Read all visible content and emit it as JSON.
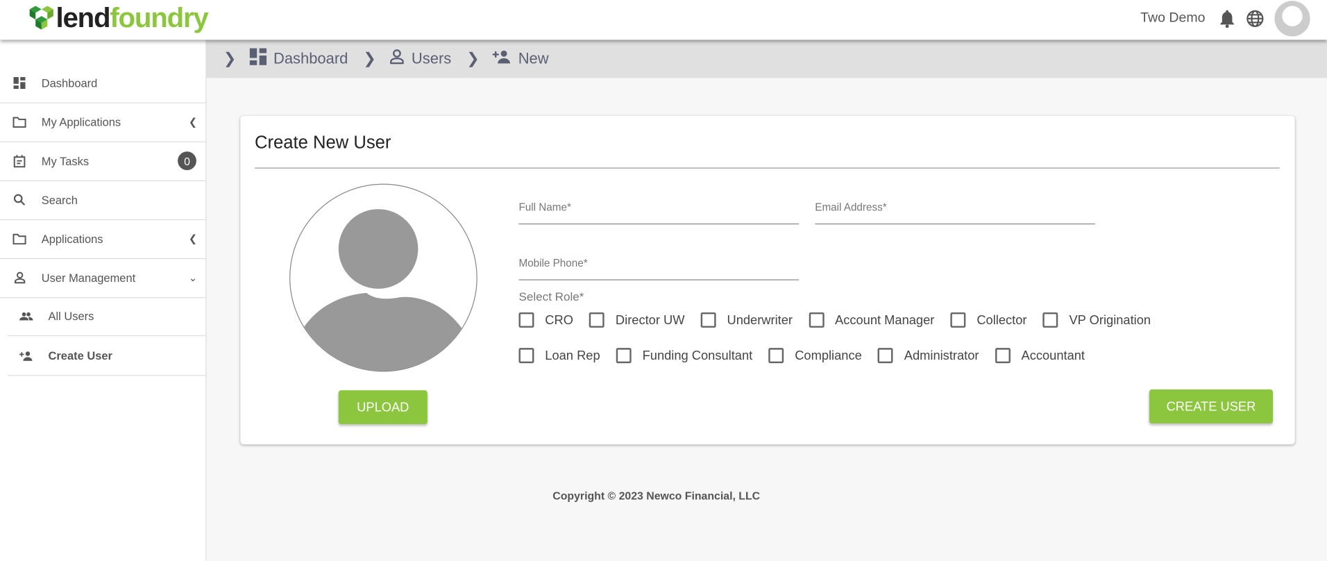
{
  "header": {
    "logo_part1": "lend",
    "logo_part2": "foundry",
    "user_name": "Two Demo"
  },
  "sidebar": {
    "items": [
      {
        "label": "Dashboard"
      },
      {
        "label": "My Applications"
      },
      {
        "label": "My Tasks",
        "badge": "0"
      },
      {
        "label": "Search"
      },
      {
        "label": "Applications"
      },
      {
        "label": "User Management"
      },
      {
        "label": "All Users"
      },
      {
        "label": "Create User"
      }
    ]
  },
  "breadcrumb": [
    "Dashboard",
    "Users",
    "New"
  ],
  "form": {
    "title": "Create New User",
    "full_name_label": "Full Name*",
    "email_label": "Email Address*",
    "phone_label": "Mobile Phone*",
    "role_label": "Select Role*",
    "roles_row1": [
      "CRO",
      "Director UW",
      "Underwriter",
      "Account Manager",
      "Collector",
      "VP Origination"
    ],
    "roles_row2": [
      "Loan Rep",
      "Funding Consultant",
      "Compliance",
      "Administrator",
      "Accountant"
    ],
    "upload_label": "UPLOAD",
    "create_label": "CREATE USER"
  },
  "footer": "Copyright © 2023 Newco Financial, LLC",
  "colors": {
    "accent": "#8cc63f"
  }
}
